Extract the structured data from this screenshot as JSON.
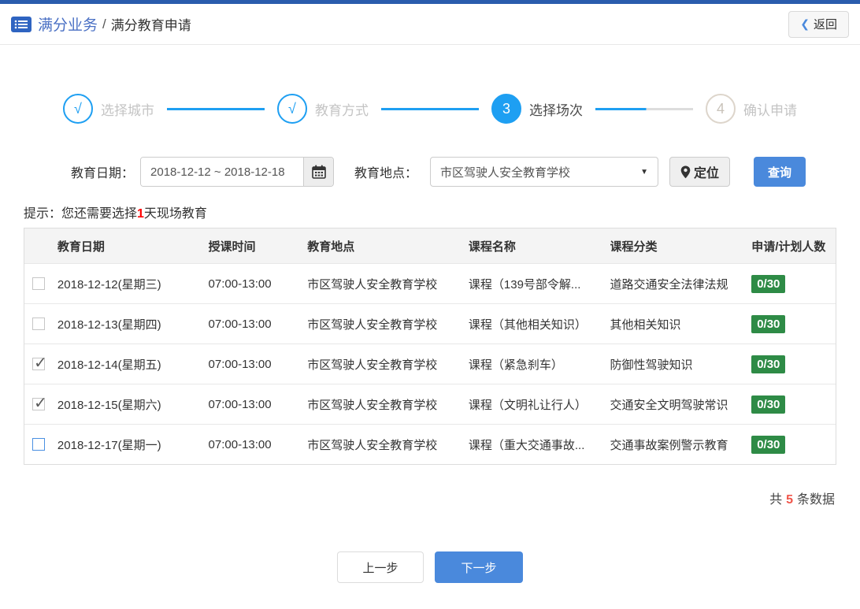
{
  "colors": {
    "topbar_blue": "#2a5cad",
    "primary_blue": "#4a89dc",
    "stepper_blue": "#1e9ff2",
    "badge_green": "#2e8b46",
    "hint_red": "#ff0000",
    "count_red": "#f0554a"
  },
  "icons": {
    "breadcrumb": "list-icon",
    "back": "chevron-left-icon",
    "date_addon": "calendar-icon",
    "place_select": "caret-down-icon",
    "locate": "location-pin-icon"
  },
  "header": {
    "breadcrumb_root": "满分业务",
    "breadcrumb_sep": "/",
    "breadcrumb_current": "满分教育申请",
    "back_chevron": "❮",
    "back_label": "返回"
  },
  "stepper": {
    "steps": [
      {
        "marker": "√",
        "label": "选择城市",
        "state": "done"
      },
      {
        "marker": "√",
        "label": "教育方式",
        "state": "done"
      },
      {
        "marker": "3",
        "label": "选择场次",
        "state": "active"
      },
      {
        "marker": "4",
        "label": "确认申请",
        "state": "pending"
      }
    ]
  },
  "filters": {
    "date_label": "教育日期：",
    "date_value": "2018-12-12 ~ 2018-12-18",
    "place_label": "教育地点：",
    "place_value": "市区驾驶人安全教育学校",
    "select_caret": "▼",
    "locate_label": "定位",
    "search_label": "查询"
  },
  "hint": {
    "prefix": "提示：您还需要选择",
    "number": "1",
    "suffix": "天现场教育"
  },
  "table": {
    "headers": [
      "教育日期",
      "授课时间",
      "教育地点",
      "课程名称",
      "课程分类",
      "申请/计划人数"
    ],
    "rows": [
      {
        "checked": false,
        "focus": false,
        "date": "2018-12-12(星期三)",
        "time": "07:00-13:00",
        "place": "市区驾驶人安全教育学校",
        "course": "课程（139号部令解...",
        "category": "道路交通安全法律法规",
        "quota": "0/30"
      },
      {
        "checked": false,
        "focus": false,
        "date": "2018-12-13(星期四)",
        "time": "07:00-13:00",
        "place": "市区驾驶人安全教育学校",
        "course": "课程（其他相关知识）",
        "category": "其他相关知识",
        "quota": "0/30"
      },
      {
        "checked": true,
        "focus": false,
        "date": "2018-12-14(星期五)",
        "time": "07:00-13:00",
        "place": "市区驾驶人安全教育学校",
        "course": "课程（紧急刹车）",
        "category": "防御性驾驶知识",
        "quota": "0/30"
      },
      {
        "checked": true,
        "focus": false,
        "date": "2018-12-15(星期六)",
        "time": "07:00-13:00",
        "place": "市区驾驶人安全教育学校",
        "course": "课程（文明礼让行人）",
        "category": "交通安全文明驾驶常识",
        "quota": "0/30"
      },
      {
        "checked": false,
        "focus": true,
        "date": "2018-12-17(星期一)",
        "time": "07:00-13:00",
        "place": "市区驾驶人安全教育学校",
        "course": "课程（重大交通事故...",
        "category": "交通事故案例警示教育",
        "quota": "0/30"
      }
    ]
  },
  "summary": {
    "prefix": "共",
    "count": "5",
    "suffix": "条数据"
  },
  "footer": {
    "prev_label": "上一步",
    "next_label": "下一步"
  }
}
